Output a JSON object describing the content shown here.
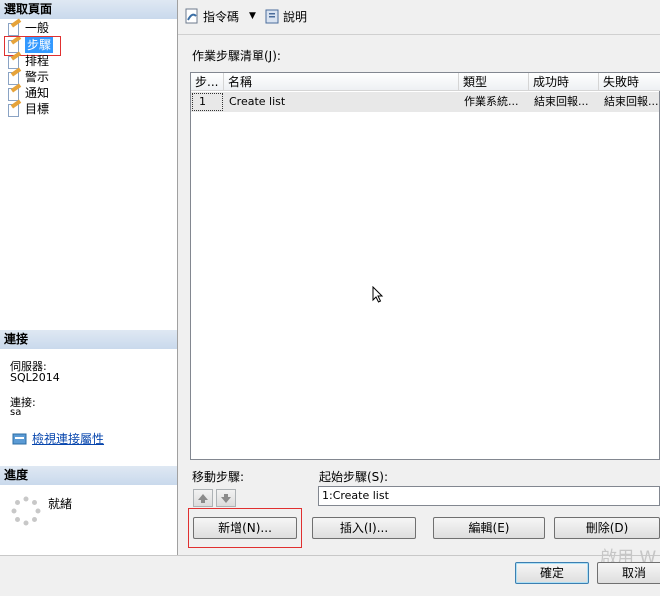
{
  "left": {
    "select_page_header": "選取頁面",
    "nav": [
      {
        "label": "一般"
      },
      {
        "label": "步驟"
      },
      {
        "label": "排程"
      },
      {
        "label": "警示"
      },
      {
        "label": "通知"
      },
      {
        "label": "目標"
      }
    ],
    "connection_header": "連接",
    "server_label": "伺服器:",
    "server_value": "SQL2014",
    "connection_label": "連接:",
    "connection_value": "sa",
    "view_props_link": "檢視連接屬性",
    "progress_header": "進度",
    "progress_status": "就緒"
  },
  "toolbar": {
    "script_label": "指令碼",
    "help_label": "說明"
  },
  "main": {
    "list_label": "作業步驟清單(J):",
    "columns": [
      "步...",
      "名稱",
      "類型",
      "成功時",
      "失敗時"
    ],
    "rows": [
      [
        "1",
        "Create list",
        "作業系統...",
        "結束回報...",
        "結束回報..."
      ]
    ],
    "move_step_label": "移動步驟:",
    "start_step_label": "起始步驟(S):",
    "start_step_value": "1:Create list",
    "buttons": {
      "new": "新增(N)...",
      "insert": "插入(I)...",
      "edit": "編輯(E)",
      "delete": "刪除(D)"
    }
  },
  "footer": {
    "ok": "確定",
    "cancel": "取消"
  },
  "watermark": "啟用 W"
}
